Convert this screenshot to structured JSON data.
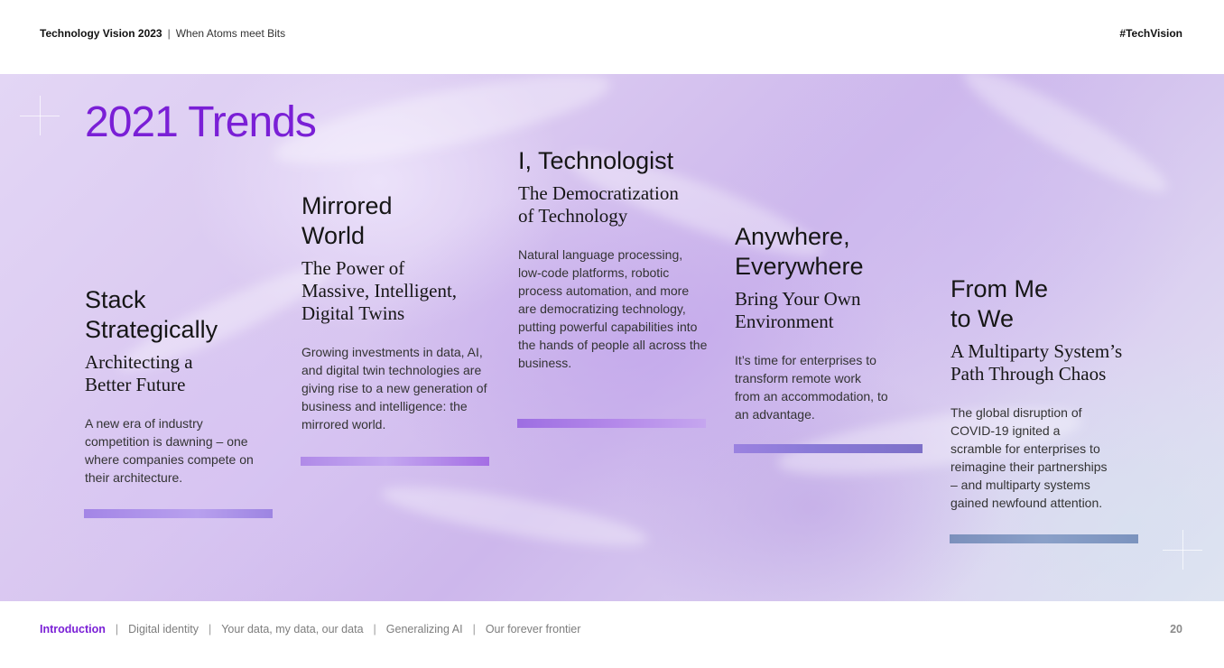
{
  "header": {
    "title": "Technology Vision 2023",
    "separator": "|",
    "subtitle": "When Atoms meet Bits",
    "hashtag": "#TechVision"
  },
  "hero": {
    "title": "2021 Trends"
  },
  "trends": [
    {
      "heading": "Stack Strategically",
      "subheading": "Architecting a Better Future",
      "body": "A new era of industry competition is dawning – one where companies compete on their architecture."
    },
    {
      "heading": "Mirrored World",
      "subheading": "The Power of Massive, Intelligent, Digital Twins",
      "body": "Growing investments in data, AI, and digital twin technologies are giving rise to a new generation of business and intelligence: the mirrored world."
    },
    {
      "heading": "I, Technologist",
      "subheading": "The Democratization of Technology",
      "body": "Natural language processing, low-code platforms, robotic process automation, and more are democratizing technology, putting powerful capabilities into the hands of people all across the business."
    },
    {
      "heading": "Anywhere, Everywhere",
      "subheading": "Bring Your Own Environment",
      "body": "It’s time for enterprises to transform remote work from an accommodation, to an advantage."
    },
    {
      "heading": "From Me to We",
      "subheading": "A Multiparty System’s Path Through Chaos",
      "body": "The global disruption of COVID-19 ignited a scramble for enterprises to reimagine their partnerships – and multiparty systems gained newfound attention."
    }
  ],
  "colors": {
    "accent": "#7a1fd6",
    "bar_1": "#a385e6",
    "bar_2": "#b08ae8",
    "bar_3": "#9d6ee2",
    "bar_4": "#8878d4",
    "bar_5": "#7d95c0"
  },
  "footer": {
    "nav": [
      {
        "label": "Introduction",
        "active": true
      },
      {
        "label": "Digital identity",
        "active": false
      },
      {
        "label": "Your data, my data, our data",
        "active": false
      },
      {
        "label": "Generalizing AI",
        "active": false
      },
      {
        "label": "Our forever frontier",
        "active": false
      }
    ],
    "separator": "|",
    "page_number": "20"
  }
}
